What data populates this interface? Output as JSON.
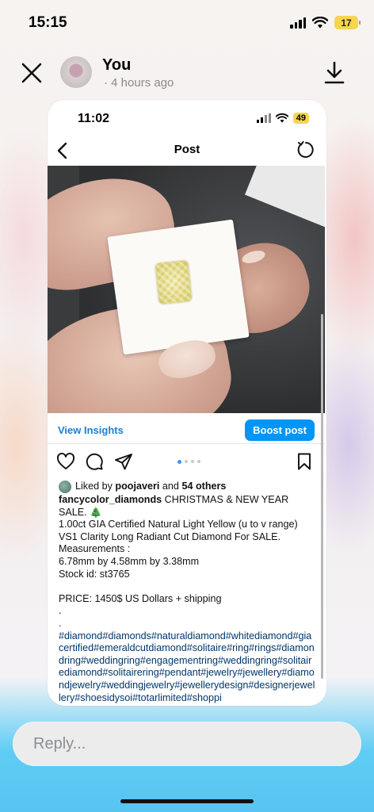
{
  "status_bar": {
    "time": "15:15",
    "battery": "17"
  },
  "header": {
    "user_name": "You",
    "time_ago": "· 4 hours ago"
  },
  "story": {
    "status_bar": {
      "time": "11:02",
      "battery": "49"
    },
    "nav": {
      "title": "Post"
    },
    "insights": {
      "view_insights_label": "View Insights",
      "boost_label": "Boost post"
    },
    "carousel": {
      "count": 4,
      "active_index": 0
    },
    "likes": {
      "prefix": "Liked by",
      "user": "poojaveri",
      "conjunction": "and",
      "others": "54 others"
    },
    "caption": {
      "username": "fancycolor_diamonds",
      "line1": "CHRISTMAS & NEW YEAR SALE. 🎄",
      "line2": "1.00ct GIA Certified Natural Light Yellow (u to v range) VS1 Clarity Long Radiant Cut Diamond For SALE.",
      "line3": "Measurements :",
      "line4": "6.78mm by 4.58mm by 3.38mm",
      "line5": "Stock id: st3765",
      "line6": "PRICE: 1450$ US Dollars + shipping",
      "dot1": ".",
      "dot2": ".",
      "hashtags": "#diamond#diamonds#naturaldiamond#whitediamond#giacertified#emeraldcutdiamond#solitaire#ring#rings#diamondring#weddingring#engagementring#weddingring#solitairediamond#solitairering#pendant#jewelry#jewellery#diamondjewelry#weddingjewelry#jewellerydesign#designerjewellery#shoesidysoi#totarlimited#shoppi"
    }
  },
  "reply": {
    "placeholder": "Reply..."
  },
  "colors": {
    "accent": "#0095f6",
    "link": "#1c7ed6",
    "hashtag": "#00376b",
    "battery": "#f7d54c"
  }
}
